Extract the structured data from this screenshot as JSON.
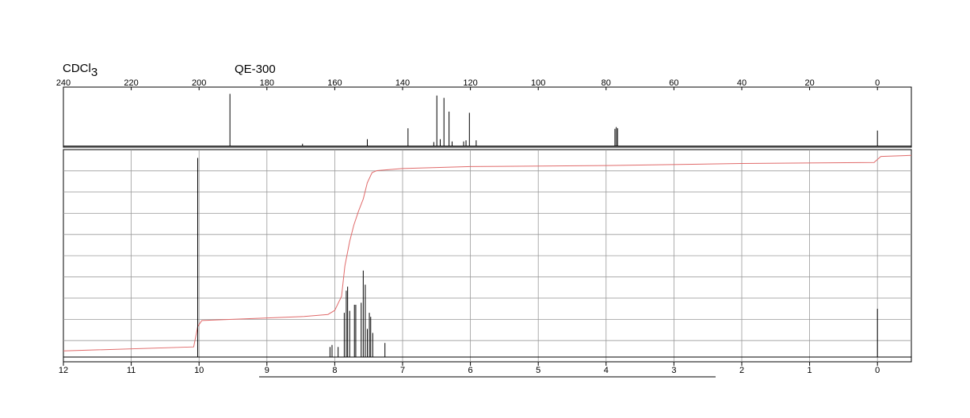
{
  "header": {
    "solvent_main": "CDCl",
    "solvent_sub": "3",
    "instrument": "QE-300"
  },
  "chart_data": [
    {
      "type": "line",
      "name": "13C NMR spectrum",
      "xlabel": "",
      "ylabel": "",
      "xlim": [
        240,
        -10
      ],
      "x_reversed": true,
      "tick_labels": [
        "240",
        "220",
        "200",
        "180",
        "160",
        "140",
        "120",
        "100",
        "80",
        "60",
        "40",
        "20",
        "0"
      ],
      "ticks": [
        240,
        220,
        200,
        180,
        160,
        140,
        120,
        100,
        80,
        60,
        40,
        20,
        0
      ],
      "ylim": [
        0,
        1
      ],
      "peaks": [
        {
          "x": 190.9,
          "y": 0.91
        },
        {
          "x": 169.5,
          "y": 0.04
        },
        {
          "x": 150.4,
          "y": 0.12
        },
        {
          "x": 138.4,
          "y": 0.31
        },
        {
          "x": 130.8,
          "y": 0.07
        },
        {
          "x": 129.9,
          "y": 0.88
        },
        {
          "x": 128.9,
          "y": 0.12
        },
        {
          "x": 127.8,
          "y": 0.84
        },
        {
          "x": 126.3,
          "y": 0.6
        },
        {
          "x": 125.4,
          "y": 0.08
        },
        {
          "x": 122.0,
          "y": 0.08
        },
        {
          "x": 121.3,
          "y": 0.1
        },
        {
          "x": 120.3,
          "y": 0.58
        },
        {
          "x": 118.3,
          "y": 0.1
        },
        {
          "x": 77.4,
          "y": 0.3
        },
        {
          "x": 77.0,
          "y": 0.33
        },
        {
          "x": 76.6,
          "y": 0.31
        },
        {
          "x": 0.0,
          "y": 0.27
        }
      ]
    },
    {
      "type": "line",
      "name": "1H NMR spectrum",
      "xlabel": "",
      "ylabel": "",
      "xlim": [
        12,
        -0.5
      ],
      "x_reversed": true,
      "tick_labels": [
        "12",
        "11",
        "10",
        "9",
        "8",
        "7",
        "6",
        "5",
        "4",
        "3",
        "2",
        "1",
        "0"
      ],
      "ticks": [
        12,
        11,
        10,
        9,
        8,
        7,
        6,
        5,
        4,
        3,
        2,
        1,
        0
      ],
      "ylim": [
        0,
        1
      ],
      "grid": true,
      "peaks": [
        {
          "x": 10.02,
          "y": 0.99
        },
        {
          "x": 8.07,
          "y": 0.05
        },
        {
          "x": 8.04,
          "y": 0.06
        },
        {
          "x": 7.95,
          "y": 0.05
        },
        {
          "x": 7.86,
          "y": 0.22
        },
        {
          "x": 7.83,
          "y": 0.33
        },
        {
          "x": 7.81,
          "y": 0.35
        },
        {
          "x": 7.78,
          "y": 0.23
        },
        {
          "x": 7.71,
          "y": 0.26
        },
        {
          "x": 7.69,
          "y": 0.26
        },
        {
          "x": 7.61,
          "y": 0.27
        },
        {
          "x": 7.58,
          "y": 0.43
        },
        {
          "x": 7.55,
          "y": 0.36
        },
        {
          "x": 7.52,
          "y": 0.14
        },
        {
          "x": 7.49,
          "y": 0.22
        },
        {
          "x": 7.47,
          "y": 0.2
        },
        {
          "x": 7.44,
          "y": 0.12
        },
        {
          "x": 7.26,
          "y": 0.07
        },
        {
          "x": 0.0,
          "y": 0.24
        }
      ],
      "integral": [
        [
          12.0,
          0.03
        ],
        [
          10.08,
          0.05
        ],
        [
          10.02,
          0.15
        ],
        [
          9.96,
          0.18
        ],
        [
          8.45,
          0.2
        ],
        [
          8.1,
          0.21
        ],
        [
          8.0,
          0.23
        ],
        [
          7.9,
          0.3
        ],
        [
          7.85,
          0.45
        ],
        [
          7.78,
          0.57
        ],
        [
          7.72,
          0.65
        ],
        [
          7.65,
          0.72
        ],
        [
          7.58,
          0.78
        ],
        [
          7.52,
          0.86
        ],
        [
          7.45,
          0.91
        ],
        [
          7.38,
          0.92
        ],
        [
          7.0,
          0.93
        ],
        [
          6.0,
          0.94
        ],
        [
          4.0,
          0.945
        ],
        [
          2.0,
          0.955
        ],
        [
          0.05,
          0.96
        ],
        [
          -0.05,
          0.99
        ],
        [
          -0.5,
          0.995
        ]
      ]
    }
  ]
}
